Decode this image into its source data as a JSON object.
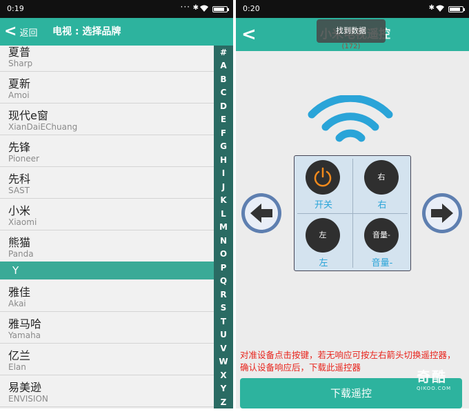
{
  "left_screen": {
    "status_bar": {
      "time": "0:19",
      "battery_level": 0.85
    },
    "header": {
      "back_label": "返回",
      "title": "电视 : 选择品牌"
    },
    "brands_before": [
      {
        "name": "夏普",
        "pinyin": "Sharp"
      },
      {
        "name": "夏新",
        "pinyin": "Amoi"
      },
      {
        "name": "现代e窗",
        "pinyin": "XianDaiEChuang"
      },
      {
        "name": "先锋",
        "pinyin": "Pioneer"
      },
      {
        "name": "先科",
        "pinyin": "SAST"
      },
      {
        "name": "小米",
        "pinyin": "Xiaomi"
      },
      {
        "name": "熊猫",
        "pinyin": "Panda"
      }
    ],
    "section_letter": "Y",
    "brands_after": [
      {
        "name": "雅佳",
        "pinyin": "Akai"
      },
      {
        "name": "雅马哈",
        "pinyin": "Yamaha"
      },
      {
        "name": "亿兰",
        "pinyin": "Elan"
      },
      {
        "name": "易美逊",
        "pinyin": "ENVISION"
      }
    ],
    "alphabet": [
      "#",
      "A",
      "B",
      "C",
      "D",
      "E",
      "F",
      "G",
      "H",
      "I",
      "J",
      "K",
      "L",
      "M",
      "N",
      "O",
      "P",
      "Q",
      "R",
      "S",
      "T",
      "U",
      "V",
      "W",
      "X",
      "Y",
      "Z"
    ]
  },
  "right_screen": {
    "status_bar": {
      "time": "0:20",
      "battery_level": 0.85
    },
    "header": {
      "title": "小米电视遥控"
    },
    "toast": {
      "message": "找到数据",
      "count": "(172)"
    },
    "keys": [
      {
        "button": "",
        "caption": "开关",
        "icon": "power-icon"
      },
      {
        "button": "右",
        "caption": "右"
      },
      {
        "button": "左",
        "caption": "左"
      },
      {
        "button": "音量-",
        "caption": "音量-"
      }
    ],
    "hint": "对准设备点击按键，若无响应可按左右箭头切换遥控器，确认设备响应后，下载此遥控器",
    "download_label": "下载遥控"
  },
  "watermark": {
    "mark": "奇酷",
    "site": "QIKOO.COM"
  },
  "colors": {
    "accent": "#2db39e",
    "alpha_bar": "#2a6b63",
    "hint": "#e8241c",
    "key_caption": "#2aa4d8",
    "signal": "#2aa4d8"
  }
}
